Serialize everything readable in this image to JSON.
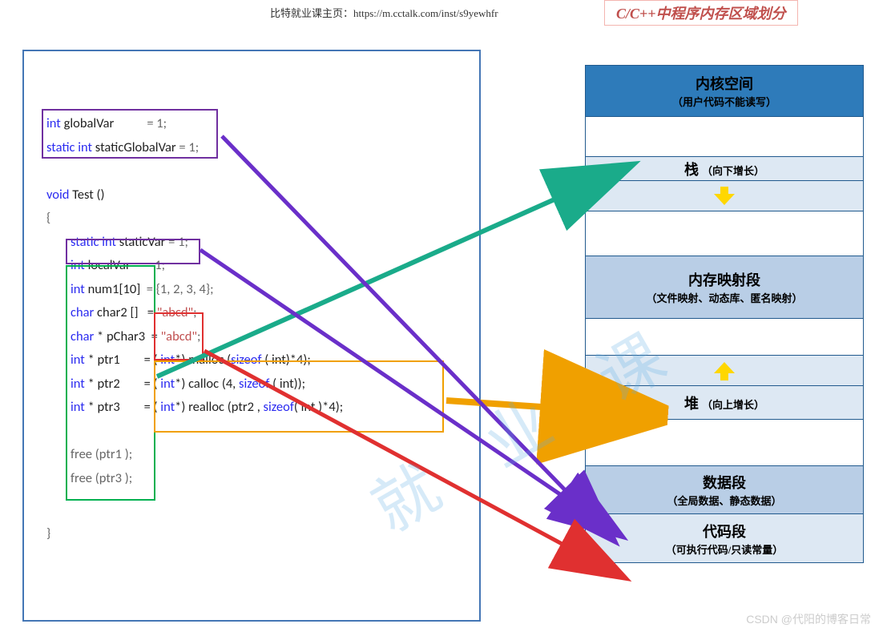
{
  "header": {
    "url_text": "比特就业课主页：https://m.cctalk.com/inst/s9yewhfr",
    "title": "C/C++中程序内存区域划分"
  },
  "code": {
    "l0_kw": "int",
    "l0_id": " globalVar",
    "l0_tail": "           = 1;",
    "l1_kw": "static int",
    "l1_id": " staticGlobalVar",
    "l1_tail": " = 1;",
    "l2": " ",
    "l3_kw": "void",
    "l3_id": " Test ()",
    "l4": "{",
    "l5_kw": "static int",
    "l5_id": " staticVar",
    "l5_tail": " = 1;",
    "l6_kw": "int",
    "l6_id": " localVar",
    "l6_tail": "     = 1;",
    "l7_kw": "int",
    "l7_id": " num1[10]",
    "l7_tail": "  = {1, 2, 3, 4};",
    "l8_kw": "char",
    "l8_id": " char2 []   = ",
    "l8_str": "\"abcd\"",
    "l8_tail": ";",
    "l9_kw": "char",
    "l9_id": " * pChar3  = ",
    "l9_str": "\"abcd\"",
    "l9_tail": ";",
    "l10_kw": "int",
    "l10_id": " * ptr1        = ( ",
    "l10_kw2": "int",
    "l10_mid": "*) malloc (",
    "l10_kw3": "sizeof",
    "l10_tail": " ( int)*4);",
    "l11_kw": "int",
    "l11_id": " * ptr2        = ( ",
    "l11_kw2": "int",
    "l11_mid": "*) calloc (4, ",
    "l11_kw3": "sizeof",
    "l11_tail": " ( int));",
    "l12_kw": "int",
    "l12_id": " * ptr3        = ( ",
    "l12_kw2": "int",
    "l12_mid": "*) realloc (ptr2 , ",
    "l12_kw3": "sizeof",
    "l12_tail": "( int )*4);",
    "l13": "",
    "l14": "free (ptr1 );",
    "l15": "free (ptr3 );",
    "l16": "}"
  },
  "memory": {
    "kernel_title": "内核空间",
    "kernel_sub": "（用户代码不能读写）",
    "stack_title": "栈",
    "stack_sub": "（向下增长）",
    "mmap_title": "内存映射段",
    "mmap_sub": "（文件映射、动态库、匿名映射）",
    "heap_title": "堆",
    "heap_sub": "（向上增长）",
    "data_title": "数据段",
    "data_sub": "（全局数据、静态数据）",
    "code_title": "代码段",
    "code_sub": "（可执行代码/只读常量）"
  },
  "watermark": "CSDN @代阳的博客日常"
}
